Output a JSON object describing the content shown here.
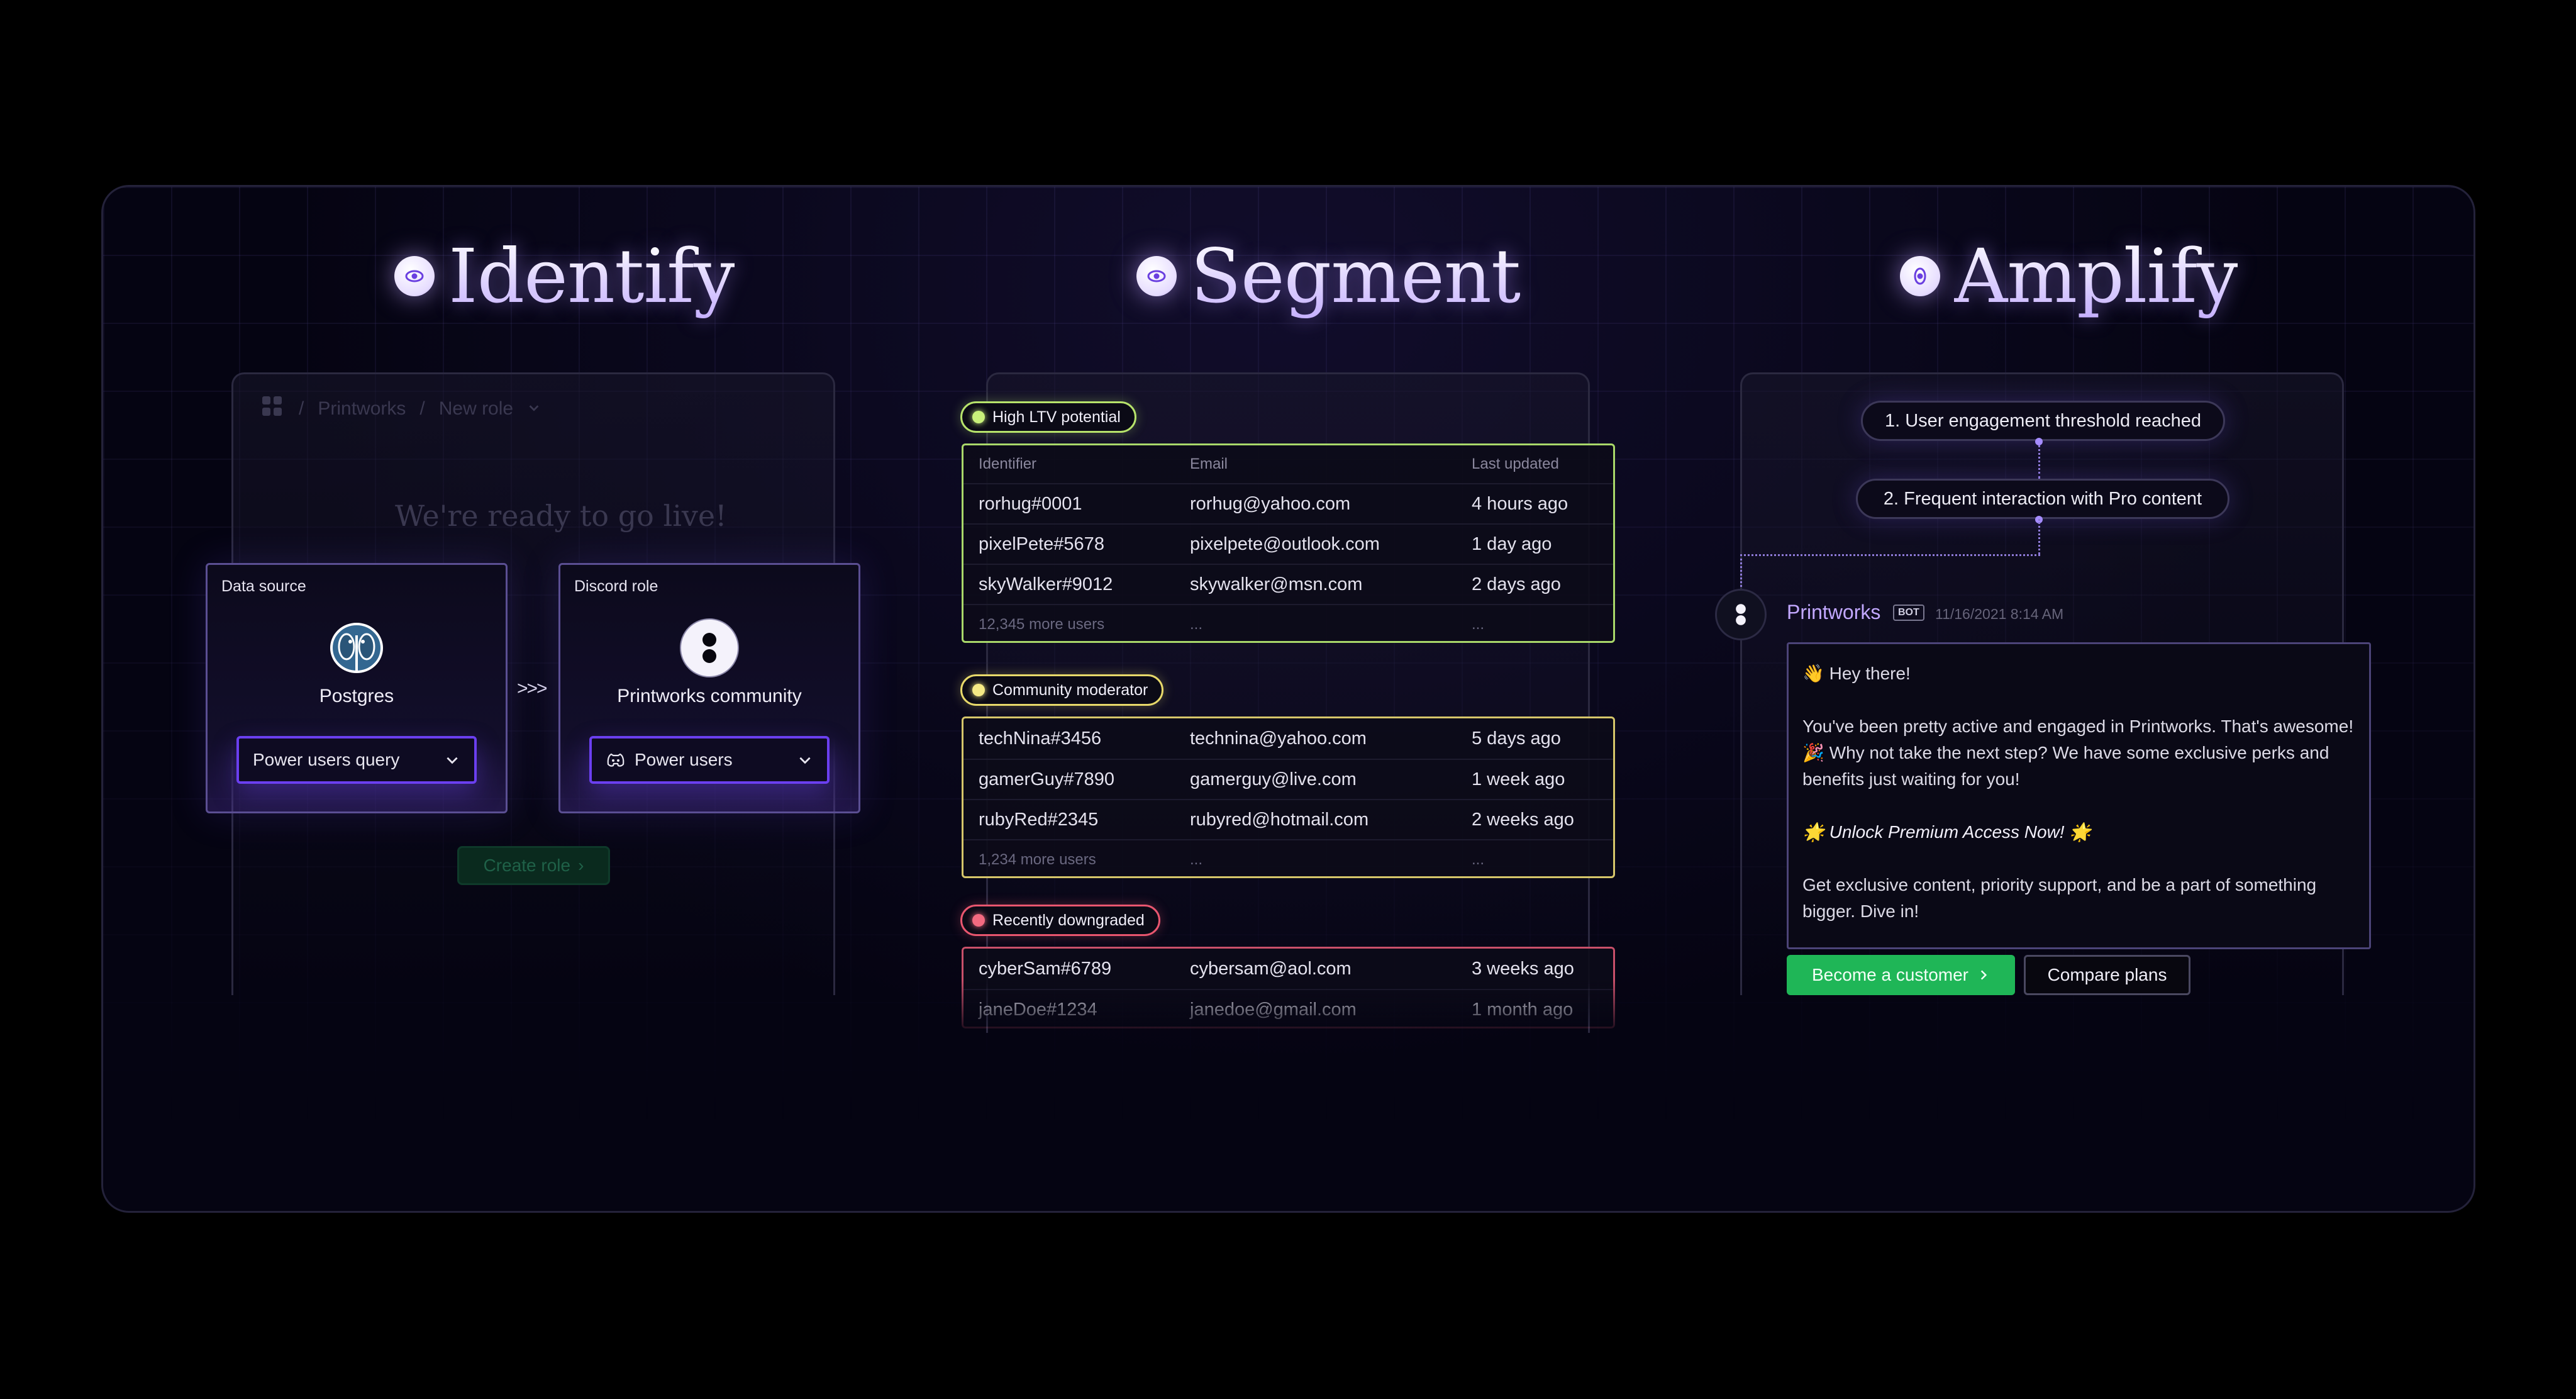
{
  "sections": {
    "identify": "Identify",
    "segment": "Segment",
    "amplify": "Amplify"
  },
  "identify": {
    "breadcrumb_app": "Printworks",
    "breadcrumb_page": "New role",
    "ghost_title": "We're ready to go live!",
    "create_button": "Create role",
    "source_card": {
      "label": "Data source",
      "name": "Postgres",
      "select_value": "Power users query"
    },
    "role_card": {
      "label": "Discord role",
      "name": "Printworks community",
      "select_value": "Power users"
    },
    "connector": ">>>"
  },
  "segment": {
    "columns": [
      "Identifier",
      "Email",
      "Last updated"
    ],
    "groups": [
      {
        "tag": "High LTV potential",
        "color": "#b7e36b",
        "rows": [
          [
            "rorhug#0001",
            "rorhug@yahoo.com",
            "4 hours ago"
          ],
          [
            "pixelPete#5678",
            "pixelpete@outlook.com",
            "1 day ago"
          ],
          [
            "skyWalker#9012",
            "skywalker@msn.com",
            "2 days ago"
          ]
        ],
        "more": [
          "12,345 more users",
          "...",
          "..."
        ]
      },
      {
        "tag": "Community moderator",
        "color": "#f2e36e",
        "rows": [
          [
            "techNina#3456",
            "technina@yahoo.com",
            "5 days ago"
          ],
          [
            "gamerGuy#7890",
            "gamerguy@live.com",
            "1 week ago"
          ],
          [
            "rubyRed#2345",
            "rubyred@hotmail.com",
            "2 weeks ago"
          ]
        ],
        "more": [
          "1,234 more users",
          "...",
          "..."
        ]
      },
      {
        "tag": "Recently downgraded",
        "color": "#f0607a",
        "rows": [
          [
            "cyberSam#6789",
            "cybersam@aol.com",
            "3 weeks ago"
          ],
          [
            "janeDoe#1234",
            "janedoe@gmail.com",
            "1 month ago"
          ]
        ]
      }
    ]
  },
  "amplify": {
    "step1": "1. User engagement threshold reached",
    "step2": "2. Frequent interaction with Pro content",
    "bot_name": "Printworks",
    "bot_badge": "BOT",
    "bot_time": "11/16/2021 8:14 AM",
    "message": {
      "greeting": "👋 Hey there!",
      "body": "You've been pretty active and engaged in Printworks. That's awesome! 🎉 Why not take the next step? We have some exclusive perks and benefits just waiting for you!",
      "cta": "🌟 Unlock Premium Access Now! 🌟",
      "closing": "Get exclusive content, priority support, and be a part of something bigger. Dive in!"
    },
    "primary_button": "Become a customer",
    "secondary_button": "Compare plans"
  },
  "colors": {
    "accent": "#6b3ff0",
    "primary_button": "#1fb657",
    "bot_name": "#c2a8ff"
  }
}
